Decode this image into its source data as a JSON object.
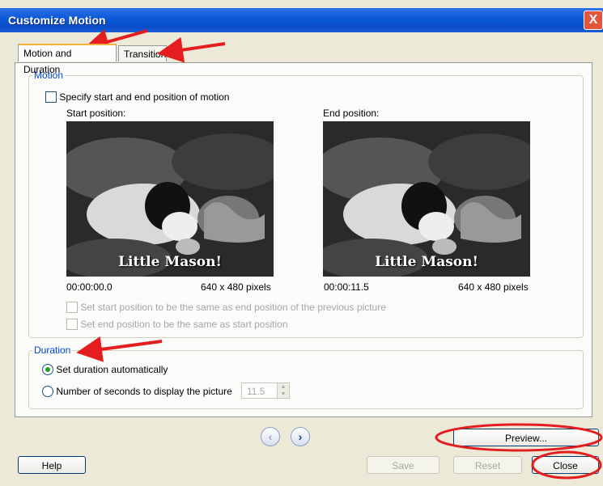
{
  "window": {
    "title": "Customize Motion",
    "close_glyph": "X"
  },
  "tabs": [
    {
      "label": "Motion and Duration"
    },
    {
      "label": "Transition"
    }
  ],
  "motion": {
    "legend": "Motion",
    "specify_label": "Specify start and end position of motion",
    "start_label": "Start position:",
    "end_label": "End position:",
    "caption": "Little Mason!",
    "start_time": "00:00:00.0",
    "end_time": "00:00:11.5",
    "start_size": "640 x 480 pixels",
    "end_size": "640 x 480 pixels",
    "same_as_prev_label": "Set start position to be the same as end position of the previous picture",
    "same_as_start_label": "Set end position to be the same as start position"
  },
  "duration": {
    "legend": "Duration",
    "auto_label": "Set duration automatically",
    "seconds_label": "Number of seconds to display the picture",
    "seconds_value": "11.5"
  },
  "buttons": {
    "preview": "Preview...",
    "help": "Help",
    "save": "Save",
    "reset": "Reset",
    "close": "Close"
  },
  "nav": {
    "back_glyph": "‹",
    "forward_glyph": "›"
  },
  "colors": {
    "annotation_red": "#e41e1e",
    "title_blue": "#0b4cc6",
    "legend_blue": "#0046d5"
  }
}
